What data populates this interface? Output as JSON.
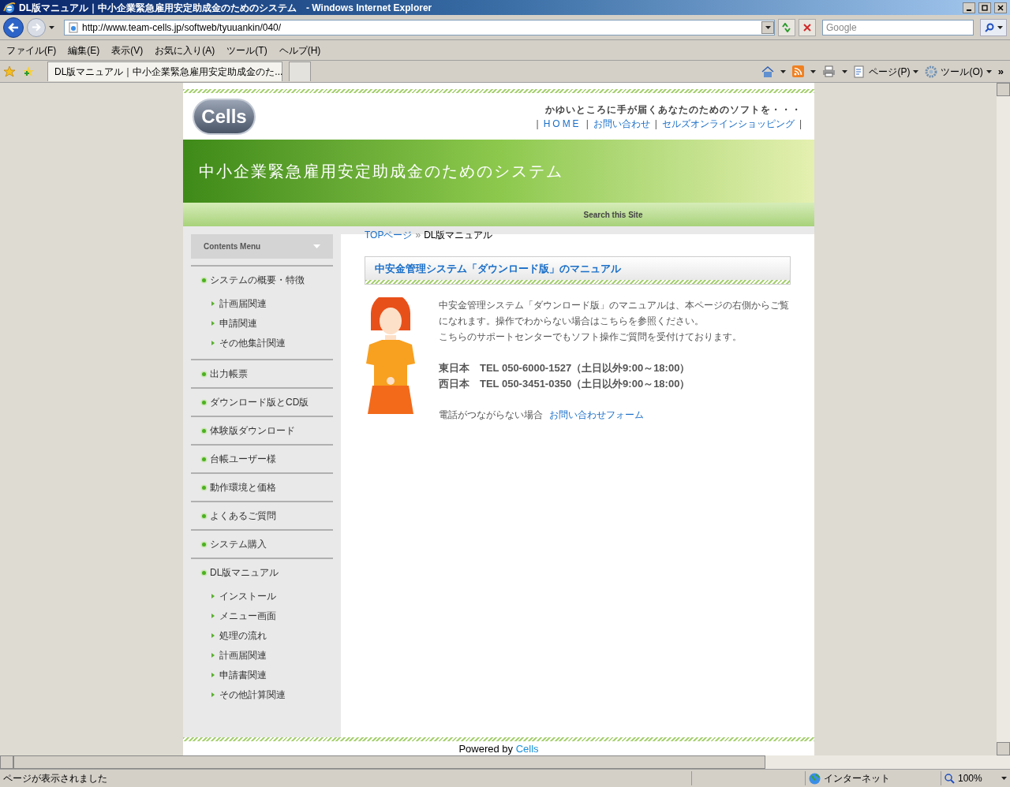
{
  "window": {
    "title": "DL版マニュアル｜中小企業緊急雇用安定助成金のためのシステム　- Windows Internet Explorer"
  },
  "address_bar": {
    "url": "http://www.team-cells.jp/softweb/tyuuankin/040/"
  },
  "search_box": {
    "placeholder": "Google"
  },
  "menu_bar": [
    "ファイル(F)",
    "編集(E)",
    "表示(V)",
    "お気に入り(A)",
    "ツール(T)",
    "ヘルプ(H)"
  ],
  "tabs": [
    {
      "label": "DL版マニュアル｜中小企業緊急雇用安定助成金のた...",
      "selected": true
    }
  ],
  "command_bar": {
    "page": "ページ(P)",
    "tools": "ツール(O)",
    "overflow": "»"
  },
  "page": {
    "logo": "Cells",
    "tagline": "かゆいところに手が届くあなたのためのソフトを・・・",
    "header_links": [
      "HOME",
      "お問い合わせ",
      "セルズオンラインショッピング"
    ],
    "header_link_separator": "|",
    "banner_title": "中小企業緊急雇用安定助成金のためのシステム",
    "search_label": "Search this Site",
    "sidebar": {
      "heading": "Contents Menu",
      "sections": [
        {
          "label": "システムの概要・特徴",
          "children": [
            "計画届関連",
            "申請関連",
            "その他集計関連"
          ]
        },
        {
          "label": "出力帳票"
        },
        {
          "label": "ダウンロード版とCD版"
        },
        {
          "label": "体験版ダウンロード"
        },
        {
          "label": "台帳ユーザー様"
        },
        {
          "label": "動作環境と価格"
        },
        {
          "label": "よくあるご質問"
        },
        {
          "label": "システム購入"
        },
        {
          "label": "DL版マニュアル",
          "children": [
            "インストール",
            "メニュー画面",
            "処理の流れ",
            "計画届関連",
            "申請書関連",
            "その他計算関連"
          ]
        }
      ]
    },
    "breadcrumb": {
      "link": "TOPページ",
      "separator": "»",
      "current": "DL版マニュアル"
    },
    "heading": "中安金管理システム「ダウンロード版」のマニュアル",
    "paragraphs": [
      "中安金管理システム「ダウンロード版」のマニュアルは、本ページの右側からご覧になれます。操作でわからない場合はこちらを参照ください。",
      "こちらのサポートセンターでもソフト操作ご質問を受付けております。"
    ],
    "contacts": [
      "東日本　TEL 050-6000-1527（土日以外9:00～18:00）",
      "西日本　TEL 050-3451-0350（土日以外9:00～18:00）"
    ],
    "fallback": {
      "text": "電話がつながらない場合",
      "link": "お問い合わせフォーム"
    },
    "footer": {
      "text": "Powered by",
      "link": "Cells"
    }
  },
  "status_bar": {
    "text": "ページが表示されました",
    "zone": "インターネット",
    "zoom": "100%"
  }
}
